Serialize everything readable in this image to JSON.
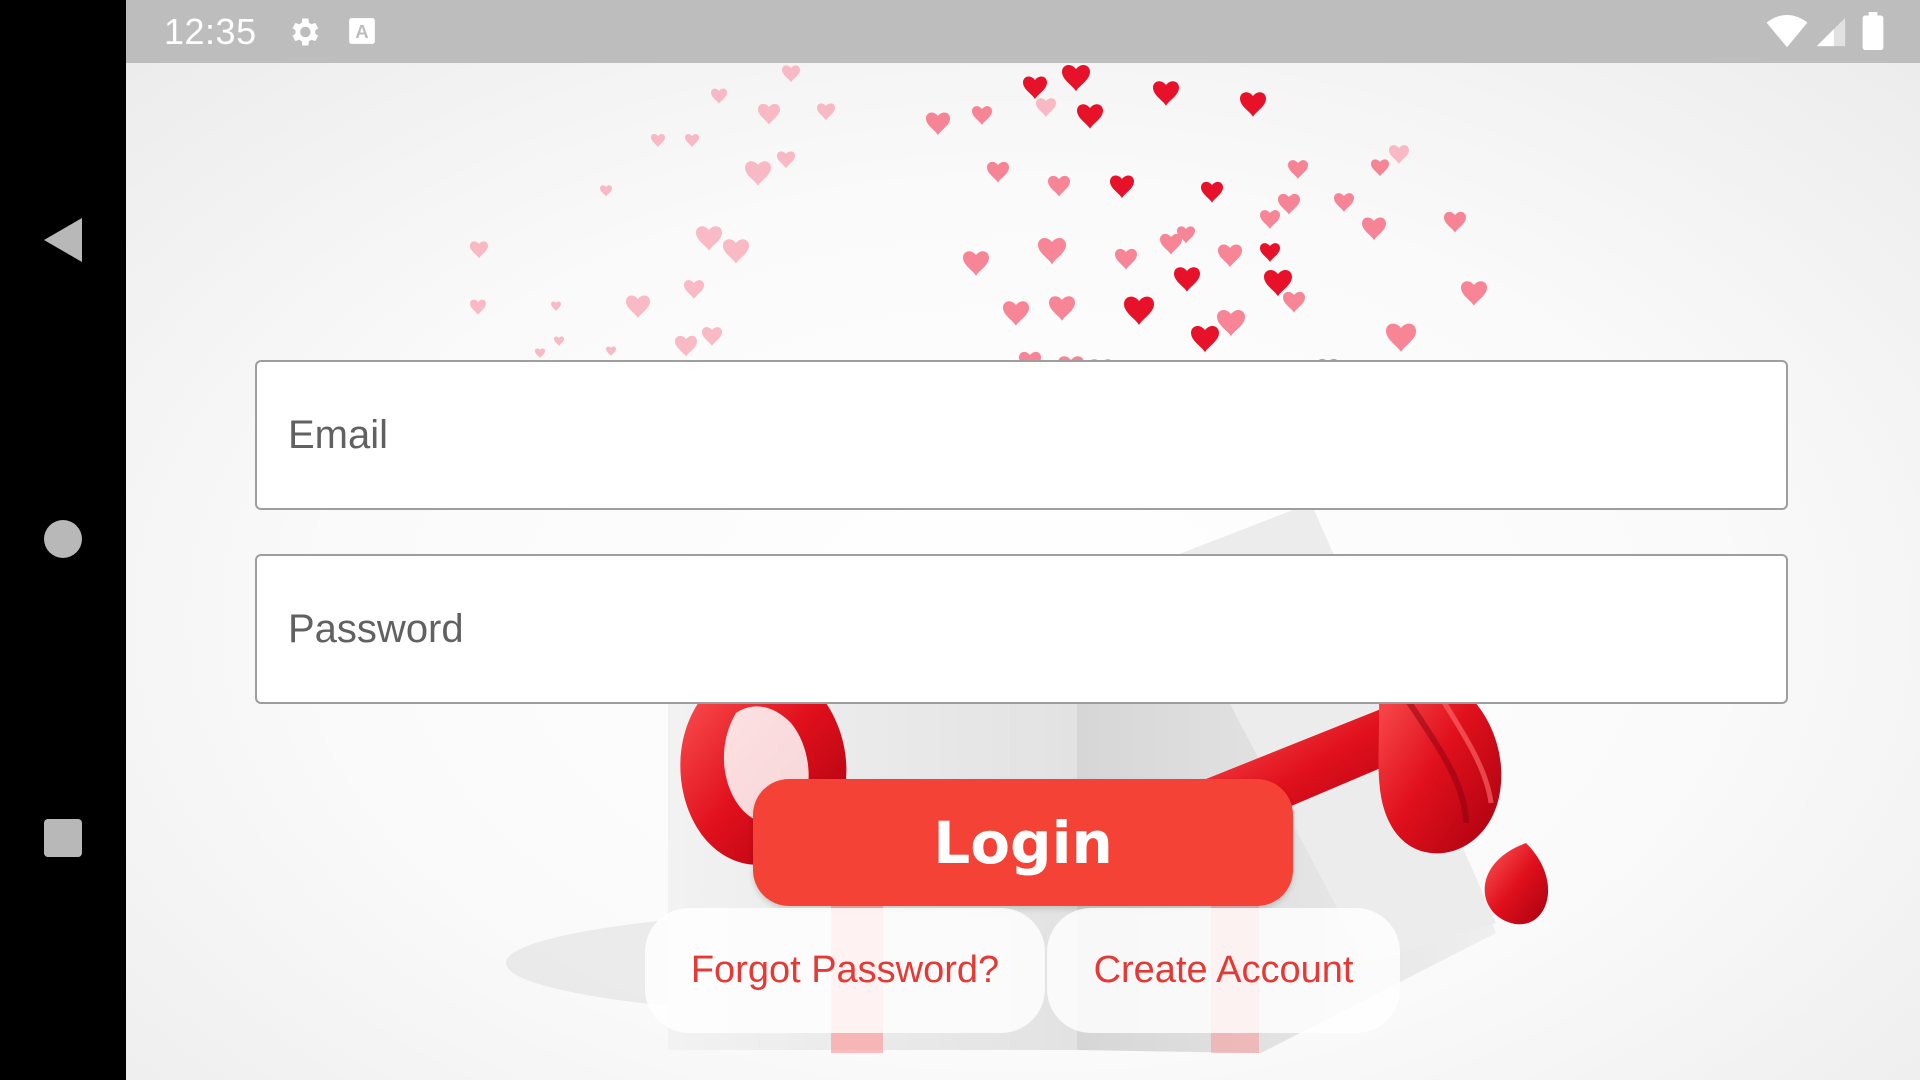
{
  "status_bar": {
    "time": "12:35",
    "icons": [
      "gear-icon",
      "a-notification-icon",
      "wifi-icon",
      "signal-icon",
      "battery-icon"
    ]
  },
  "nav_bar": {
    "buttons": [
      "back-icon",
      "home-icon",
      "recents-icon"
    ]
  },
  "login_form": {
    "email_placeholder": "Email",
    "password_placeholder": "Password",
    "login_label": "Login",
    "forgot_password_label": "Forgot Password?",
    "create_account_label": "Create Account"
  },
  "colors": {
    "accent": "#f44336",
    "link_text": "#e53935",
    "status_bar": "#bdbdbd",
    "nav_bar": "#000000"
  }
}
